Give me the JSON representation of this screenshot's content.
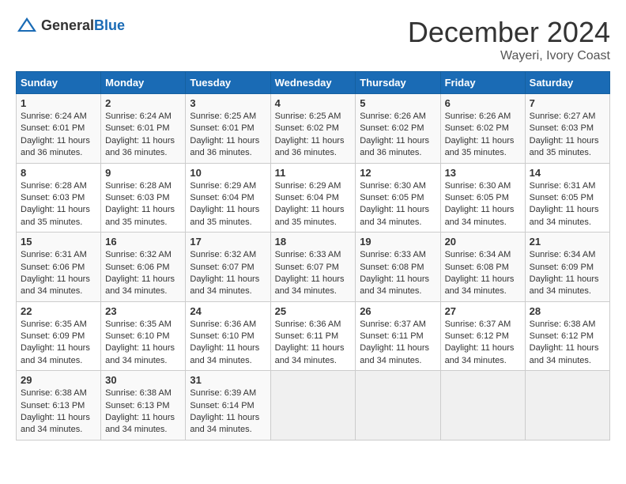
{
  "logo": {
    "general": "General",
    "blue": "Blue"
  },
  "header": {
    "month": "December 2024",
    "location": "Wayeri, Ivory Coast"
  },
  "weekdays": [
    "Sunday",
    "Monday",
    "Tuesday",
    "Wednesday",
    "Thursday",
    "Friday",
    "Saturday"
  ],
  "weeks": [
    [
      {
        "day": "1",
        "sunrise": "6:24 AM",
        "sunset": "6:01 PM",
        "daylight": "11 hours and 36 minutes."
      },
      {
        "day": "2",
        "sunrise": "6:24 AM",
        "sunset": "6:01 PM",
        "daylight": "11 hours and 36 minutes."
      },
      {
        "day": "3",
        "sunrise": "6:25 AM",
        "sunset": "6:01 PM",
        "daylight": "11 hours and 36 minutes."
      },
      {
        "day": "4",
        "sunrise": "6:25 AM",
        "sunset": "6:02 PM",
        "daylight": "11 hours and 36 minutes."
      },
      {
        "day": "5",
        "sunrise": "6:26 AM",
        "sunset": "6:02 PM",
        "daylight": "11 hours and 36 minutes."
      },
      {
        "day": "6",
        "sunrise": "6:26 AM",
        "sunset": "6:02 PM",
        "daylight": "11 hours and 35 minutes."
      },
      {
        "day": "7",
        "sunrise": "6:27 AM",
        "sunset": "6:03 PM",
        "daylight": "11 hours and 35 minutes."
      }
    ],
    [
      {
        "day": "8",
        "sunrise": "6:28 AM",
        "sunset": "6:03 PM",
        "daylight": "11 hours and 35 minutes."
      },
      {
        "day": "9",
        "sunrise": "6:28 AM",
        "sunset": "6:03 PM",
        "daylight": "11 hours and 35 minutes."
      },
      {
        "day": "10",
        "sunrise": "6:29 AM",
        "sunset": "6:04 PM",
        "daylight": "11 hours and 35 minutes."
      },
      {
        "day": "11",
        "sunrise": "6:29 AM",
        "sunset": "6:04 PM",
        "daylight": "11 hours and 35 minutes."
      },
      {
        "day": "12",
        "sunrise": "6:30 AM",
        "sunset": "6:05 PM",
        "daylight": "11 hours and 34 minutes."
      },
      {
        "day": "13",
        "sunrise": "6:30 AM",
        "sunset": "6:05 PM",
        "daylight": "11 hours and 34 minutes."
      },
      {
        "day": "14",
        "sunrise": "6:31 AM",
        "sunset": "6:05 PM",
        "daylight": "11 hours and 34 minutes."
      }
    ],
    [
      {
        "day": "15",
        "sunrise": "6:31 AM",
        "sunset": "6:06 PM",
        "daylight": "11 hours and 34 minutes."
      },
      {
        "day": "16",
        "sunrise": "6:32 AM",
        "sunset": "6:06 PM",
        "daylight": "11 hours and 34 minutes."
      },
      {
        "day": "17",
        "sunrise": "6:32 AM",
        "sunset": "6:07 PM",
        "daylight": "11 hours and 34 minutes."
      },
      {
        "day": "18",
        "sunrise": "6:33 AM",
        "sunset": "6:07 PM",
        "daylight": "11 hours and 34 minutes."
      },
      {
        "day": "19",
        "sunrise": "6:33 AM",
        "sunset": "6:08 PM",
        "daylight": "11 hours and 34 minutes."
      },
      {
        "day": "20",
        "sunrise": "6:34 AM",
        "sunset": "6:08 PM",
        "daylight": "11 hours and 34 minutes."
      },
      {
        "day": "21",
        "sunrise": "6:34 AM",
        "sunset": "6:09 PM",
        "daylight": "11 hours and 34 minutes."
      }
    ],
    [
      {
        "day": "22",
        "sunrise": "6:35 AM",
        "sunset": "6:09 PM",
        "daylight": "11 hours and 34 minutes."
      },
      {
        "day": "23",
        "sunrise": "6:35 AM",
        "sunset": "6:10 PM",
        "daylight": "11 hours and 34 minutes."
      },
      {
        "day": "24",
        "sunrise": "6:36 AM",
        "sunset": "6:10 PM",
        "daylight": "11 hours and 34 minutes."
      },
      {
        "day": "25",
        "sunrise": "6:36 AM",
        "sunset": "6:11 PM",
        "daylight": "11 hours and 34 minutes."
      },
      {
        "day": "26",
        "sunrise": "6:37 AM",
        "sunset": "6:11 PM",
        "daylight": "11 hours and 34 minutes."
      },
      {
        "day": "27",
        "sunrise": "6:37 AM",
        "sunset": "6:12 PM",
        "daylight": "11 hours and 34 minutes."
      },
      {
        "day": "28",
        "sunrise": "6:38 AM",
        "sunset": "6:12 PM",
        "daylight": "11 hours and 34 minutes."
      }
    ],
    [
      {
        "day": "29",
        "sunrise": "6:38 AM",
        "sunset": "6:13 PM",
        "daylight": "11 hours and 34 minutes."
      },
      {
        "day": "30",
        "sunrise": "6:38 AM",
        "sunset": "6:13 PM",
        "daylight": "11 hours and 34 minutes."
      },
      {
        "day": "31",
        "sunrise": "6:39 AM",
        "sunset": "6:14 PM",
        "daylight": "11 hours and 34 minutes."
      },
      null,
      null,
      null,
      null
    ]
  ],
  "labels": {
    "sunrise": "Sunrise: ",
    "sunset": "Sunset: ",
    "daylight": "Daylight: "
  }
}
